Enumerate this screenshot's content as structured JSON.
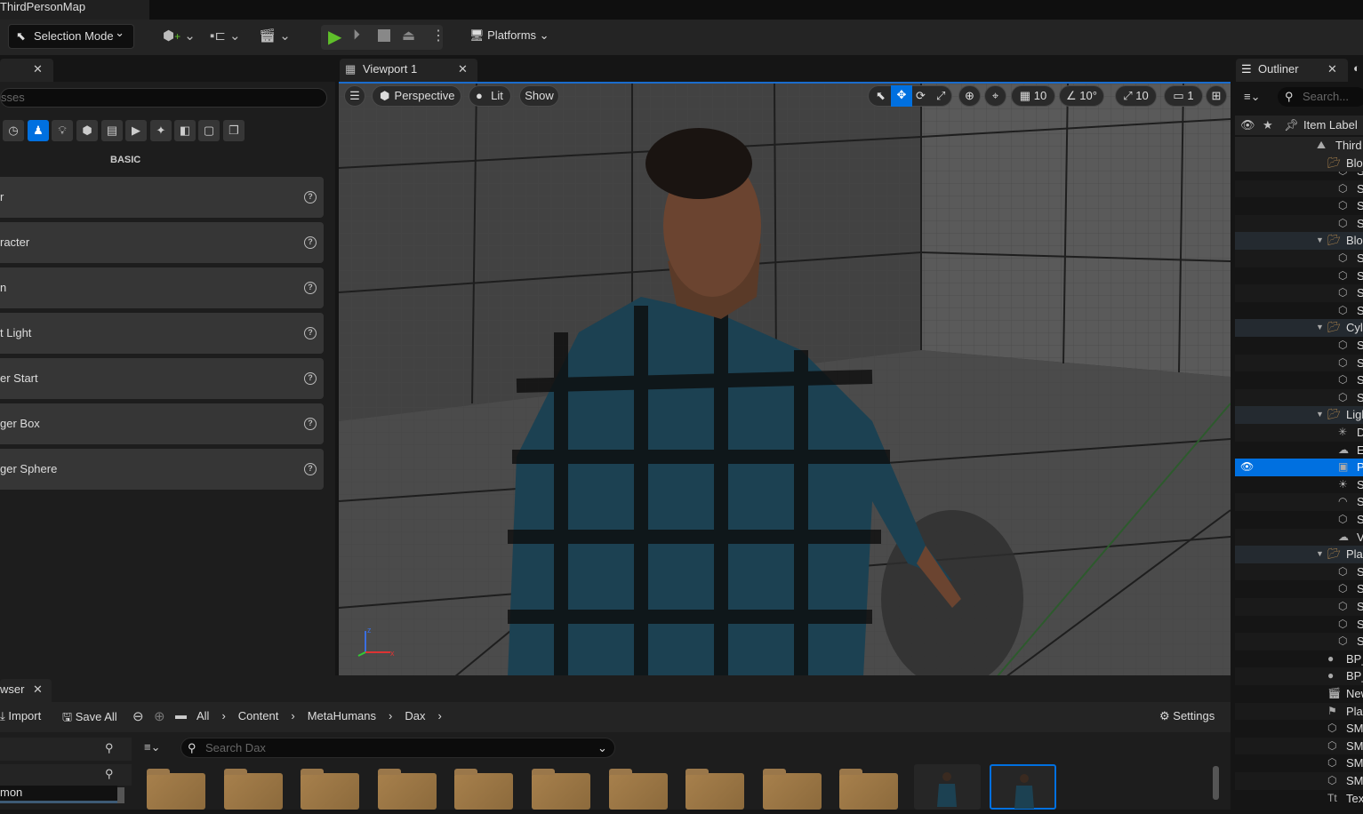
{
  "title_tab": "ThirdPersonMap",
  "toolbar": {
    "selection_mode": "Selection Mode",
    "platforms": "Platforms"
  },
  "place_actors": {
    "search_placeholder": "sses",
    "category_label": "BASIC",
    "items": [
      "r",
      "racter",
      "n",
      "t Light",
      "er Start",
      "ger Box",
      "ger Sphere"
    ]
  },
  "viewport": {
    "tab": "Viewport 1",
    "perspective": "Perspective",
    "lit": "Lit",
    "show": "Show",
    "grid_snap": "10",
    "rotation_snap": "10°",
    "scale_snap": "10",
    "camera_speed": "1"
  },
  "outliner": {
    "tab": "Outliner",
    "search_placeholder": "Search...",
    "column_label": "Item Label",
    "sticky_rows": [
      {
        "label": "Third",
        "icon": "level-icon"
      },
      {
        "label": "Blo",
        "icon": "folder-icon"
      }
    ],
    "rows": [
      {
        "label": "S",
        "icon": "static-mesh-icon",
        "indent": 2
      },
      {
        "label": "S",
        "icon": "static-mesh-icon",
        "indent": 2
      },
      {
        "label": "S",
        "icon": "static-mesh-icon",
        "indent": 2
      },
      {
        "label": "S",
        "icon": "static-mesh-icon",
        "indent": 2
      },
      {
        "label": "Blo",
        "icon": "folder-icon",
        "indent": 1
      },
      {
        "label": "S",
        "icon": "static-mesh-icon",
        "indent": 2
      },
      {
        "label": "S",
        "icon": "static-mesh-icon",
        "indent": 2
      },
      {
        "label": "S",
        "icon": "static-mesh-icon",
        "indent": 2
      },
      {
        "label": "S",
        "icon": "static-mesh-icon",
        "indent": 2
      },
      {
        "label": "Cyl",
        "icon": "folder-icon",
        "indent": 1
      },
      {
        "label": "S",
        "icon": "static-mesh-icon",
        "indent": 2
      },
      {
        "label": "S",
        "icon": "static-mesh-icon",
        "indent": 2
      },
      {
        "label": "S",
        "icon": "static-mesh-icon",
        "indent": 2
      },
      {
        "label": "S",
        "icon": "static-mesh-icon",
        "indent": 2
      },
      {
        "label": "Ligl",
        "icon": "folder-icon",
        "indent": 1
      },
      {
        "label": "D",
        "icon": "directional-light-icon",
        "indent": 2
      },
      {
        "label": "E",
        "icon": "exponential-fog-icon",
        "indent": 2
      },
      {
        "label": "P",
        "icon": "post-process-volume-icon",
        "indent": 2,
        "selected": true
      },
      {
        "label": "S",
        "icon": "sky-atmosphere-icon",
        "indent": 2
      },
      {
        "label": "S",
        "icon": "sky-light-icon",
        "indent": 2
      },
      {
        "label": "S",
        "icon": "static-mesh-icon",
        "indent": 2
      },
      {
        "label": "V",
        "icon": "volumetric-cloud-icon",
        "indent": 2
      },
      {
        "label": "Pla",
        "icon": "folder-icon",
        "indent": 1
      },
      {
        "label": "S",
        "icon": "static-mesh-icon",
        "indent": 2
      },
      {
        "label": "S",
        "icon": "static-mesh-icon",
        "indent": 2
      },
      {
        "label": "S",
        "icon": "static-mesh-icon",
        "indent": 2
      },
      {
        "label": "S",
        "icon": "static-mesh-icon",
        "indent": 2
      },
      {
        "label": "S",
        "icon": "static-mesh-icon",
        "indent": 2
      },
      {
        "label": "BP_",
        "icon": "blueprint-actor-icon",
        "indent": 1
      },
      {
        "label": "BP_",
        "icon": "blueprint-actor-icon",
        "indent": 1
      },
      {
        "label": "New",
        "icon": "level-sequence-icon",
        "indent": 1
      },
      {
        "label": "Play",
        "icon": "player-start-icon",
        "indent": 1
      },
      {
        "label": "SM",
        "icon": "static-mesh-icon",
        "indent": 1
      },
      {
        "label": "SM",
        "icon": "static-mesh-icon",
        "indent": 1
      },
      {
        "label": "SM",
        "icon": "static-mesh-icon",
        "indent": 1
      },
      {
        "label": "SM",
        "icon": "static-mesh-icon",
        "indent": 1
      },
      {
        "label": "Tex",
        "icon": "text-render-icon",
        "indent": 1
      }
    ]
  },
  "content_browser": {
    "tab": "wser",
    "import": "Import",
    "save_all": "Save All",
    "breadcrumb": [
      "All",
      "Content",
      "MetaHumans",
      "Dax"
    ],
    "settings": "Settings",
    "search_placeholder": "Search Dax",
    "tree_item": "mon",
    "folder_count": 10,
    "thumbnail_count": 2
  },
  "colors": {
    "accent": "#0070e0",
    "play": "#5fbf2a",
    "folder": "#a7804c"
  }
}
